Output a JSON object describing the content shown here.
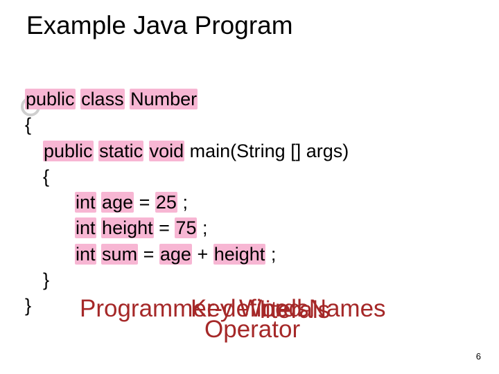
{
  "title": "Example Java Program",
  "code": {
    "l1_public": "public",
    "l1_class": "class",
    "l1_number": "Number",
    "l2": "{",
    "l3_public": "public",
    "l3_static": "static",
    "l3_void": "void",
    "l3_rest": " main(String [] args)",
    "l4": "{",
    "l5_int": "int",
    "l5_age": "age",
    "l5_eq": " = ",
    "l5_val": "25",
    "l5_semi": ";",
    "l6_int": "int",
    "l6_height": "height",
    "l6_eq": " = ",
    "l6_val": "75",
    "l6_semi": ";",
    "l7_int": "int",
    "l7_sum": "sum",
    "l7_eq": " = ",
    "l7_age": "age",
    "l7_plus": " + ",
    "l7_height": "height",
    "l7_semi": ";",
    "l8": "}",
    "l9": "}"
  },
  "overlays": {
    "o1": "Programmer-defined Names",
    "o2": "Key Words",
    "o3": "Operator",
    "o4": "literals"
  },
  "pagenum": "6"
}
